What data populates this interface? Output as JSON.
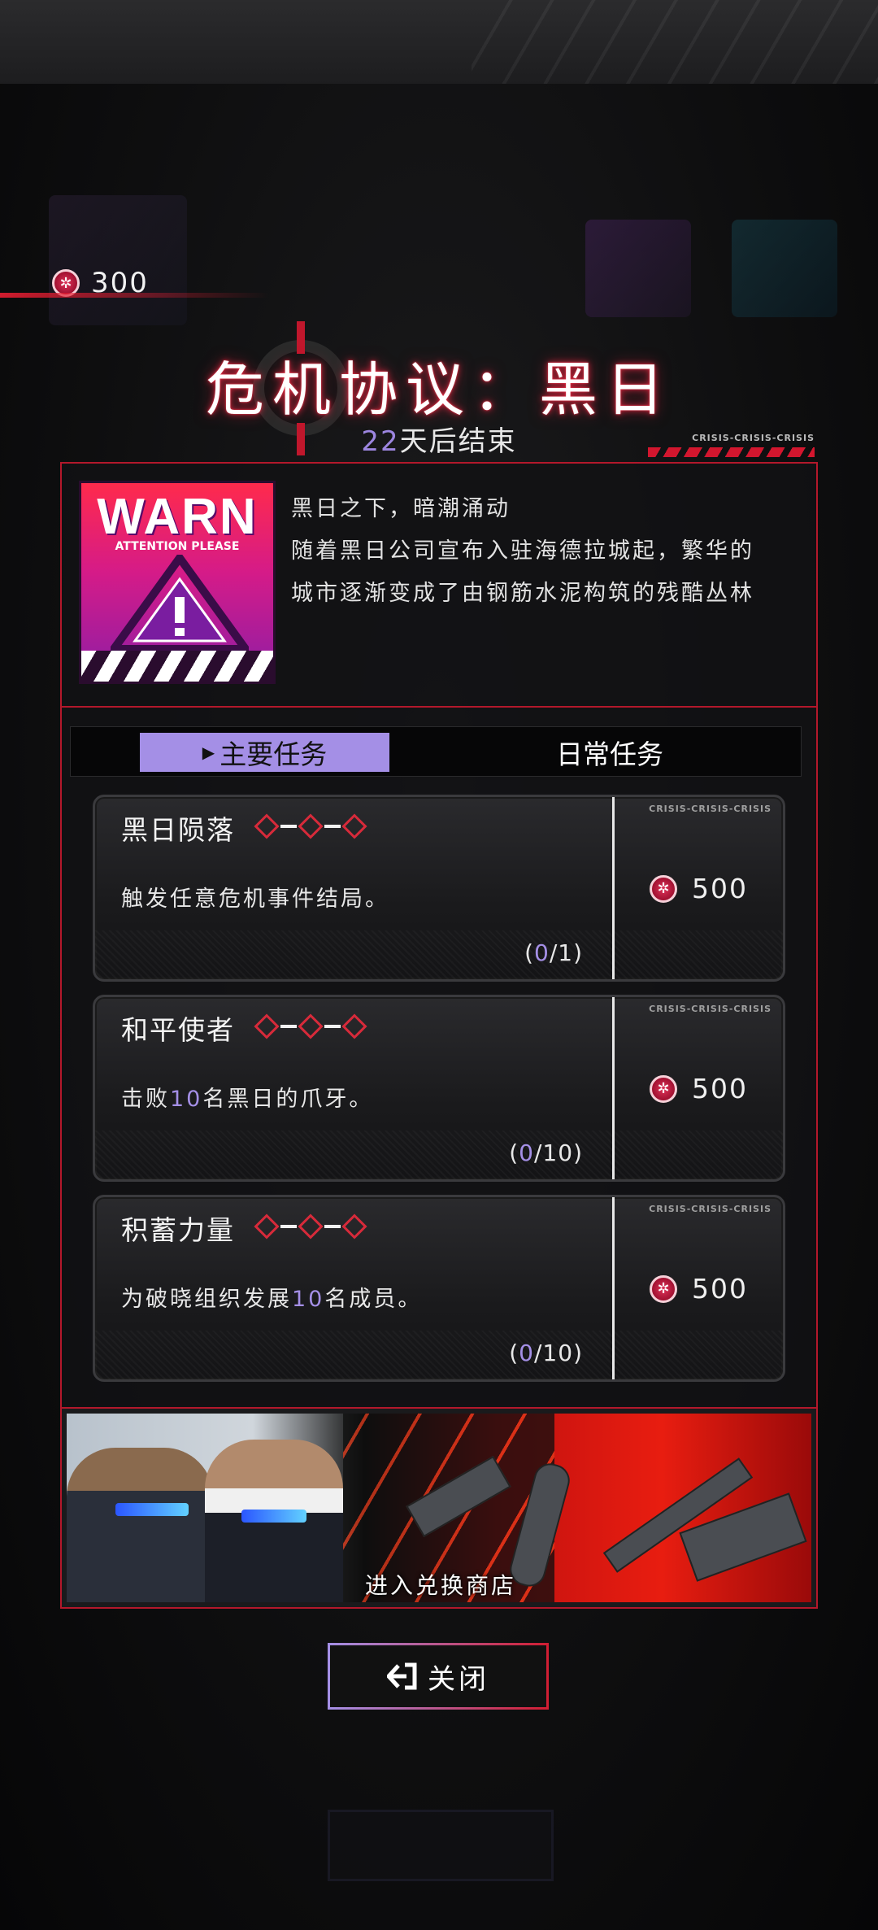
{
  "currency": {
    "icon": "crisis-coin-icon",
    "amount": "300"
  },
  "event": {
    "title": "危机协议：黑日",
    "days_left": "22",
    "days_suffix": "天后结束",
    "crisis_tag": "CRISIS-CRISIS-CRISIS"
  },
  "banner": {
    "warn_text": "WARN",
    "warn_sub": "ATTENTION PLEASE"
  },
  "description": {
    "line1": "黑日之下，暗潮涌动",
    "line2": "随着黑日公司宣布入驻海德拉城起，繁华的",
    "line3": "城市逐渐变成了由钢筋水泥构筑的残酷丛林"
  },
  "tabs": {
    "main": "主要任务",
    "daily": "日常任务"
  },
  "tasks": [
    {
      "name": "黑日陨落",
      "desc_pre": "触发任意危机事件结局。",
      "desc_hl": "",
      "desc_post": "",
      "prog_open": "(",
      "prog_done": "0",
      "prog_total": "/1)",
      "reward": "500",
      "tag": "CRISIS-CRISIS-CRISIS"
    },
    {
      "name": "和平使者",
      "desc_pre": "击败",
      "desc_hl": "10",
      "desc_post": "名黑日的爪牙。",
      "prog_open": "(",
      "prog_done": "0",
      "prog_total": "/10)",
      "reward": "500",
      "tag": "CRISIS-CRISIS-CRISIS"
    },
    {
      "name": "积蓄力量",
      "desc_pre": "为破晓组织发展",
      "desc_hl": "10",
      "desc_post": "名成员。",
      "prog_open": "(",
      "prog_done": "0",
      "prog_total": "/10)",
      "reward": "500",
      "tag": "CRISIS-CRISIS-CRISIS"
    }
  ],
  "shop": {
    "label": "进入兑换商店"
  },
  "close": {
    "icon": "exit-icon",
    "label": "关闭"
  },
  "colors": {
    "accent_red": "#b3182b",
    "accent_purple": "#a48fe6"
  }
}
